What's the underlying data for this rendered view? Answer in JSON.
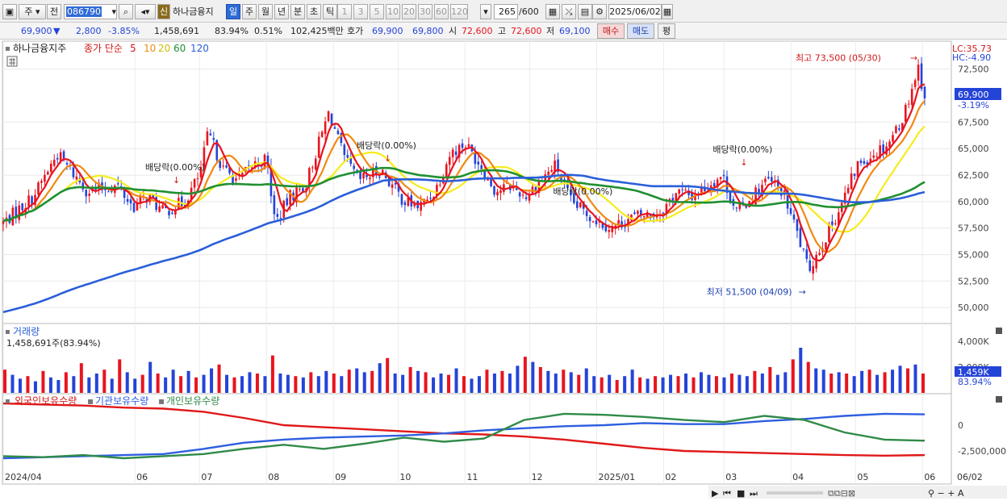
{
  "toolbar": {
    "period_select": "주",
    "prev_label": "전",
    "stock_code": "086790",
    "new_badge": "신",
    "stock_name": "하나금융지",
    "tabs": [
      "일",
      "주",
      "월",
      "년",
      "분",
      "초",
      "틱"
    ],
    "minute_tabs": [
      "1",
      "3",
      "5",
      "10",
      "20",
      "30",
      "60",
      "120"
    ],
    "count": "265",
    "count_total": "/600",
    "date": "2025/06/02"
  },
  "quote": {
    "price": "69,900",
    "change_arrow": "▼",
    "change": "2,800",
    "change_pct": "-3.85%",
    "volume": "1,458,691",
    "vol_ratio": "83.94%",
    "turnover": "0.51%",
    "amount": "102,425백만",
    "hoga_label": "호가",
    "ask": "69,900",
    "bid": "69,800",
    "open_label": "시",
    "open": "72,600",
    "high_label": "고",
    "high": "72,600",
    "low_label": "저",
    "low": "69,100",
    "buy_label": "매수",
    "sell_label": "매도",
    "eval_label": "평"
  },
  "colors": {
    "up": "#e8141e",
    "down": "#2444d8",
    "ma5": "#e8141e",
    "ma10": "#ef8a12",
    "ma20": "#f5ec1c",
    "ma60": "#1f9030",
    "ma120": "#2a5fd9",
    "foreign": "#e01818",
    "institution": "#2f5fe0",
    "individual": "#2f8a48"
  },
  "chart_data": [
    {
      "type": "candlestick",
      "title": "하나금융지주",
      "legend": [
        "종가 단순",
        "5",
        "10",
        "20",
        "60",
        "120"
      ],
      "x_ticks": [
        "2024/04",
        "06",
        "07",
        "08",
        "09",
        "10",
        "11",
        "12",
        "2025/01",
        "02",
        "03",
        "04",
        "05",
        "06",
        "06/02"
      ],
      "y_ticks": [
        "72,500",
        "67,500",
        "65,000",
        "62,500",
        "60,000",
        "57,500",
        "55,000",
        "52,500",
        "50,000"
      ],
      "ylim": [
        48000,
        75000
      ],
      "points": [
        {
          "date": "2024-04-01",
          "close": 58000
        },
        {
          "date": "2024-04-15",
          "close": 60500
        },
        {
          "date": "2024-04-26",
          "close": 64500
        },
        {
          "date": "2024-05-10",
          "close": 61000
        },
        {
          "date": "2024-05-24",
          "close": 61500
        },
        {
          "date": "2024-05-31",
          "close": 59500
        },
        {
          "date": "2024-06-07",
          "close": 60500
        },
        {
          "date": "2024-06-14",
          "close": 59000
        },
        {
          "date": "2024-06-24",
          "close": 60000
        },
        {
          "date": "2024-07-01",
          "close": 62500
        },
        {
          "date": "2024-07-05",
          "close": 66500
        },
        {
          "date": "2024-07-12",
          "close": 63000
        },
        {
          "date": "2024-07-19",
          "close": 62000
        },
        {
          "date": "2024-07-26",
          "close": 63500
        },
        {
          "date": "2024-08-01",
          "close": 64000
        },
        {
          "date": "2024-08-05",
          "close": 58000
        },
        {
          "date": "2024-08-12",
          "close": 60500
        },
        {
          "date": "2024-08-19",
          "close": 61500
        },
        {
          "date": "2024-08-26",
          "close": 66000
        },
        {
          "date": "2024-08-30",
          "close": 68500
        },
        {
          "date": "2024-09-06",
          "close": 64000
        },
        {
          "date": "2024-09-13",
          "close": 62000
        },
        {
          "date": "2024-09-23",
          "close": 63000
        },
        {
          "date": "2024-09-30",
          "close": 61000
        },
        {
          "date": "2024-10-04",
          "close": 60000
        },
        {
          "date": "2024-10-11",
          "close": 59500
        },
        {
          "date": "2024-10-18",
          "close": 61000
        },
        {
          "date": "2024-10-25",
          "close": 64500
        },
        {
          "date": "2024-11-01",
          "close": 65500
        },
        {
          "date": "2024-11-08",
          "close": 63500
        },
        {
          "date": "2024-11-15",
          "close": 61000
        },
        {
          "date": "2024-11-22",
          "close": 61500
        },
        {
          "date": "2024-11-29",
          "close": 60500
        },
        {
          "date": "2024-12-06",
          "close": 62000
        },
        {
          "date": "2024-12-13",
          "close": 63500
        },
        {
          "date": "2024-12-20",
          "close": 60000
        },
        {
          "date": "2024-12-30",
          "close": 58500
        },
        {
          "date": "2025-01-08",
          "close": 57500
        },
        {
          "date": "2025-01-17",
          "close": 58500
        },
        {
          "date": "2025-01-31",
          "close": 59000
        },
        {
          "date": "2025-02-07",
          "close": 61000
        },
        {
          "date": "2025-02-14",
          "close": 60500
        },
        {
          "date": "2025-02-21",
          "close": 61500
        },
        {
          "date": "2025-02-28",
          "close": 62500
        },
        {
          "date": "2025-03-07",
          "close": 59000
        },
        {
          "date": "2025-03-14",
          "close": 60500
        },
        {
          "date": "2025-03-21",
          "close": 62000
        },
        {
          "date": "2025-03-28",
          "close": 61000
        },
        {
          "date": "2025-04-04",
          "close": 57000
        },
        {
          "date": "2025-04-09",
          "close": 53500
        },
        {
          "date": "2025-04-18",
          "close": 57000
        },
        {
          "date": "2025-04-25",
          "close": 60000
        },
        {
          "date": "2025-05-02",
          "close": 63500
        },
        {
          "date": "2025-05-09",
          "close": 64500
        },
        {
          "date": "2025-05-16",
          "close": 65500
        },
        {
          "date": "2025-05-23",
          "close": 68000
        },
        {
          "date": "2025-05-30",
          "close": 72700
        },
        {
          "date": "2025-06-02",
          "close": 69900
        }
      ],
      "annotations": [
        {
          "text": "최고 73,500 (05/30)",
          "date": "2025-05-30",
          "value": 73500
        },
        {
          "text": "최저 51,500 (04/09)",
          "date": "2025-04-09",
          "value": 51500
        },
        {
          "text": "배당락(0.00%)",
          "date": "2024-06-20"
        },
        {
          "text": "배당락(0.00%)",
          "date": "2024-09-26"
        },
        {
          "text": "배당락(0.00%)",
          "date": "2024-12-26"
        },
        {
          "text": "배당락(0.00%)",
          "date": "2025-03-10"
        }
      ],
      "side_labels": {
        "lc": "LC:35.73",
        "hc": "HC:-4.90",
        "price": "69,900",
        "pct": "-3.19%"
      }
    },
    {
      "type": "bar",
      "title": "거래량",
      "info": "1,458,691주(83.94%)",
      "y_ticks": [
        "4,000K",
        "2,000K"
      ],
      "ylim": [
        0,
        4500
      ],
      "y_unit": "K",
      "values_k": [
        1800,
        1400,
        1100,
        1300,
        900,
        1700,
        1200,
        1000,
        1600,
        1300,
        2300,
        1200,
        1500,
        1800,
        1100,
        2600,
        1600,
        1100,
        1400,
        2400,
        1500,
        1200,
        1800,
        1300,
        1700,
        1200,
        1400,
        1900,
        2200,
        1400,
        1200,
        1300,
        1600,
        1500,
        1300,
        2900,
        1500,
        1400,
        1300,
        1200,
        1600,
        1300,
        1700,
        1500,
        1300,
        1800,
        1900,
        1600,
        1700,
        2300,
        2700,
        1500,
        1400,
        2000,
        1700,
        1600,
        1200,
        1500,
        1400,
        1900,
        1300,
        1100,
        1300,
        1800,
        1500,
        1700,
        1500,
        2100,
        2800,
        2400,
        2000,
        1700,
        1500,
        1800,
        1600,
        1400,
        1900,
        1300,
        1200,
        1400,
        1000,
        1300,
        1800,
        1200,
        1100,
        1300,
        1200,
        1400,
        1300,
        1500,
        1200,
        1600,
        1400,
        1300,
        1200,
        1500,
        1400,
        1300,
        1700,
        1500,
        2000,
        1400,
        1600,
        2600,
        3500,
        2400,
        1900,
        1800,
        1500,
        1600,
        1500,
        1300,
        1700,
        1800,
        1400,
        1600,
        1800,
        2100,
        1900,
        2200,
        1500
      ],
      "current_label": "1,459K",
      "current_pct": "83.94%"
    },
    {
      "type": "line",
      "title": "외국인보유수량 · 기관보유수량 · 개인보유수량",
      "series": [
        {
          "name": "외국인보유수량",
          "values": [
            2100000,
            2000000,
            1900000,
            1700000,
            1600000,
            1300000,
            700000,
            0,
            -200000,
            -400000,
            -600000,
            -800000,
            -900000,
            -1100000,
            -1400000,
            -1800000,
            -2200000,
            -2500000,
            -2600000,
            -2700000,
            -2800000,
            -2900000,
            -2950000,
            -2900000
          ]
        },
        {
          "name": "기관보유수량",
          "values": [
            -3200000,
            -3100000,
            -3000000,
            -2900000,
            -2800000,
            -2300000,
            -1700000,
            -1400000,
            -1200000,
            -1100000,
            -1000000,
            -800000,
            -500000,
            -300000,
            -100000,
            0,
            200000,
            100000,
            100000,
            400000,
            600000,
            900000,
            1100000,
            1050000
          ]
        },
        {
          "name": "개인보유수량",
          "values": [
            -3000000,
            -3100000,
            -2900000,
            -3200000,
            -3000000,
            -2800000,
            -2300000,
            -1900000,
            -2300000,
            -1800000,
            -1200000,
            -1600000,
            -1300000,
            500000,
            1100000,
            1000000,
            800000,
            500000,
            300000,
            900000,
            500000,
            -700000,
            -1400000,
            -1500000
          ]
        }
      ],
      "y_ticks": [
        "0",
        "-2,500,000"
      ],
      "ylim": [
        -3500000,
        2600000
      ]
    }
  ]
}
